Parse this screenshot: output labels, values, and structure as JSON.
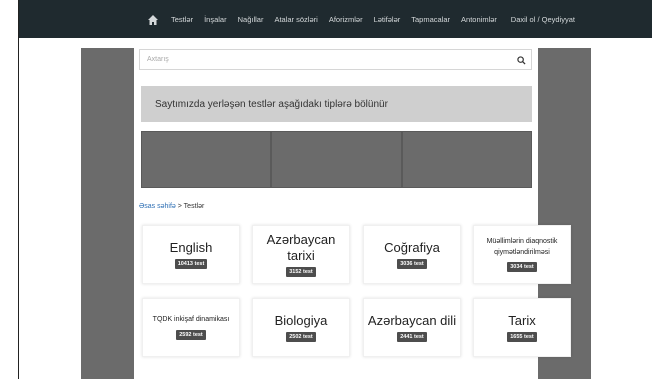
{
  "nav": {
    "items": [
      "Testlər",
      "İnşalar",
      "Nağıllar",
      "Atalar sözləri",
      "Aforizmlər",
      "Lətifələr",
      "Tapmacalar",
      "Antonimlər"
    ],
    "login": "Daxil ol / Qeydiyyat"
  },
  "search": {
    "placeholder": "Axtarış"
  },
  "banner": {
    "text": "Saytımızda yerləşən testlər aşağıdakı tiplərə bölünür"
  },
  "breadcrumb": {
    "home": "Əsas səhifə",
    "separator": ">",
    "current": "Testlər"
  },
  "categories": [
    {
      "title": "English",
      "count": "10413 test",
      "size": "big"
    },
    {
      "title": "Azərbaycan tarixi",
      "count": "3152 test",
      "size": "big"
    },
    {
      "title": "Coğrafiya",
      "count": "3036 test",
      "size": "big"
    },
    {
      "title": "Müəllimlərin diaqnostik qiymətləndirilməsi",
      "count": "3034 test",
      "size": "small"
    },
    {
      "title": "TQDK inkişaf dinamikası",
      "count": "2592 test",
      "size": "small"
    },
    {
      "title": "Biologiya",
      "count": "2502 test",
      "size": "big"
    },
    {
      "title": "Azərbaycan dili",
      "count": "2441 test",
      "size": "big"
    },
    {
      "title": "Tarix",
      "count": "1655 test",
      "size": "big"
    }
  ]
}
